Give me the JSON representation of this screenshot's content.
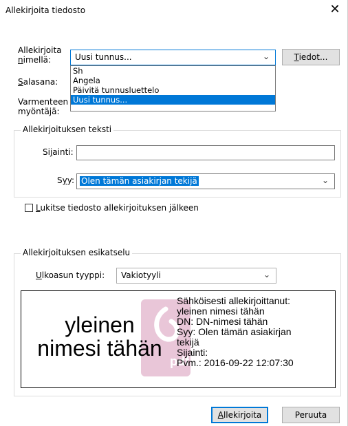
{
  "window": {
    "title": "Allekirjoita tiedosto",
    "close_glyph": "✕"
  },
  "signer": {
    "label_line1": "Allekirjoita",
    "label_line2_u": "n",
    "label_line2_rest": "imellä:",
    "selected": "Uusi tunnus...",
    "details_button": {
      "u": "T",
      "rest": "iedot..."
    },
    "options": [
      "Sh",
      "Angela",
      "Päivitä tunnusluettelo",
      "Uusi tunnus..."
    ]
  },
  "password": {
    "label_u": "S",
    "label_rest": "alasana:"
  },
  "issuer": {
    "label_line1": "Varmenteen",
    "label_line2": "myöntäjä:"
  },
  "signature_text": {
    "legend": "Allekirjoituksen teksti",
    "location": {
      "label_a": "Si",
      "label_u": "j",
      "label_b": "ainti:",
      "value": ""
    },
    "reason": {
      "label_a": "S",
      "label_u": "y",
      "label_b": "y:",
      "value": "Olen tämän asiakirjan tekijä"
    }
  },
  "lock": {
    "u": "L",
    "rest": "ukitse tiedosto allekirjoituksen jälkeen",
    "checked": false
  },
  "preview": {
    "legend": "Allekirjoituksen esikatselu",
    "appearance": {
      "label_u": "U",
      "label_rest": "lkoasun tyyppi:",
      "value": "Vakiotyyli"
    },
    "name_line1": "yleinen",
    "name_line2": "nimesi tähän",
    "details": [
      "Sähköisesti allekirjoittanut:",
      "yleinen nimesi tähän",
      "DN: DN-nimesi tähän",
      "Syy: Olen tämän asiakirjan",
      "tekijä",
      "Sijainti:",
      "Pvm.: 2016-09-22 12:07:30"
    ],
    "watermark_text": "pdf"
  },
  "buttons": {
    "sign": {
      "u": "A",
      "rest": "llekirjoita"
    },
    "cancel": "Peruuta"
  },
  "colors": {
    "accent": "#0078d7",
    "watermark": "#e9c6d8"
  },
  "icons": {
    "chevron": "chevron-down-icon",
    "close": "close-icon"
  }
}
